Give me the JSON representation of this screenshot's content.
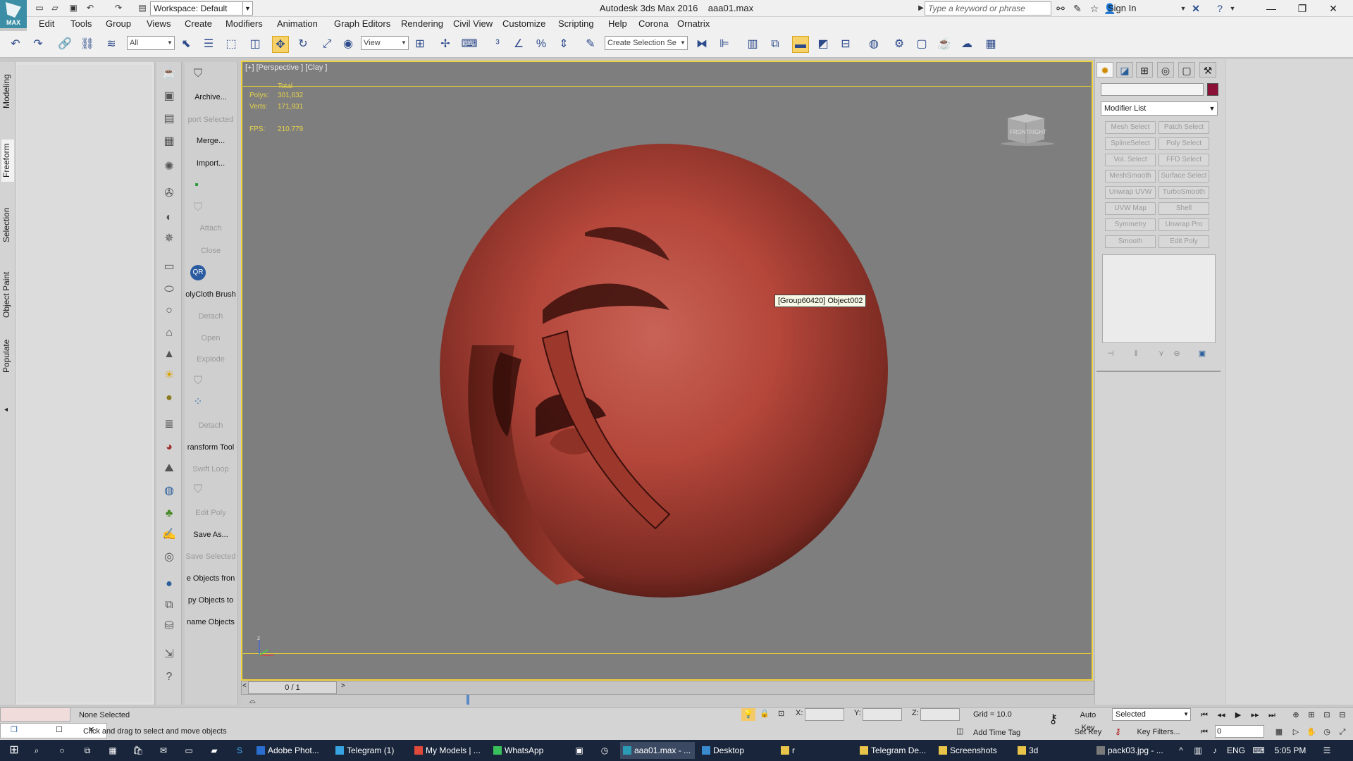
{
  "app": {
    "title": "Autodesk 3ds Max 2016",
    "filename": "aaa01.max",
    "logo_text": "MAX"
  },
  "workspace": {
    "label": "Workspace: Default"
  },
  "search": {
    "placeholder": "Type a keyword or phrase"
  },
  "signin": {
    "label": "Sign In"
  },
  "menu": [
    "Edit",
    "Tools",
    "Group",
    "Views",
    "Create",
    "Modifiers",
    "Animation",
    "Graph Editors",
    "Rendering",
    "Civil View",
    "Customize",
    "Scripting",
    "Help",
    "Corona",
    "Ornatrix"
  ],
  "toolbar": {
    "filter": "All",
    "refcoord": "View",
    "selection_set": "Create Selection Se"
  },
  "ribbon_tabs": [
    "Modeling",
    "Freeform",
    "Selection",
    "Object Paint",
    "Populate"
  ],
  "scene_tools": [
    {
      "label": "Archive...",
      "enabled": true
    },
    {
      "label": "port Selected",
      "enabled": false
    },
    {
      "label": "Merge...",
      "enabled": true
    },
    {
      "label": "Import...",
      "enabled": true
    },
    {
      "label": "Attach",
      "enabled": false
    },
    {
      "label": "Close",
      "enabled": false
    },
    {
      "label": "olyCloth Brush",
      "enabled": true
    },
    {
      "label": "Detach",
      "enabled": false
    },
    {
      "label": "Open",
      "enabled": false
    },
    {
      "label": "Explode",
      "enabled": false
    },
    {
      "label": "Detach",
      "enabled": false
    },
    {
      "label": "ransform Tool",
      "enabled": true
    },
    {
      "label": "Swift Loop",
      "enabled": false
    },
    {
      "label": "Edit Poly",
      "enabled": false
    },
    {
      "label": "Save As...",
      "enabled": true
    },
    {
      "label": "Save Selected",
      "enabled": false
    },
    {
      "label": "e Objects fron",
      "enabled": true
    },
    {
      "label": "py Objects to",
      "enabled": true
    },
    {
      "label": "name Objects",
      "enabled": true
    }
  ],
  "viewport": {
    "label": "[+] [Perspective ] [Clay ]",
    "stats_header": "Total",
    "polys_label": "Polys:",
    "polys": "301,632",
    "verts_label": "Verts:",
    "verts": "171,931",
    "fps_label": "FPS:",
    "fps": "210.779",
    "viewcube_front": "FRONT",
    "viewcube_right": "RIGHT",
    "tooltip": "[Group60420] Object002",
    "axis_label": "z"
  },
  "timeline": {
    "frame": "0 / 1"
  },
  "command_panel": {
    "modifier_list": "Modifier List",
    "modifiers": [
      "Mesh Select",
      "Patch Select",
      "SplineSelect",
      "Poly Select",
      "Vol. Select",
      "FFD Select",
      "MeshSmooth",
      "Surface Select",
      "Unwrap UVW",
      "TurboSmooth",
      "UVW Map",
      "Shell",
      "Symmetry",
      "Unwrap Pro",
      "Smooth",
      "Edit Poly"
    ]
  },
  "status": {
    "selection": "None Selected",
    "prompt": "Click and drag to select and move objects",
    "x_label": "X:",
    "y_label": "Y:",
    "z_label": "Z:",
    "grid": "Grid = 10.0",
    "add_time_tag": "Add Time Tag",
    "auto_key": "Auto Key",
    "set_key": "Set Key",
    "key_mode": "Selected",
    "key_filters": "Key Filters...",
    "current_frame": "0"
  },
  "taskbar": {
    "apps": [
      "Adobe Phot...",
      "Telegram (1)",
      "My Models | ...",
      "WhatsApp",
      "aaa01.max - ...",
      "Desktop",
      "r",
      "Telegram De...",
      "Screenshots",
      "3d",
      "pack03.jpg - ..."
    ],
    "lang": "ENG",
    "time": "5:05 PM"
  },
  "colors": {
    "accent_viewport_border": "#f0d23c",
    "object_color": "#8a1038",
    "sphere": "#b4463a",
    "taskbar": "#18253a"
  }
}
